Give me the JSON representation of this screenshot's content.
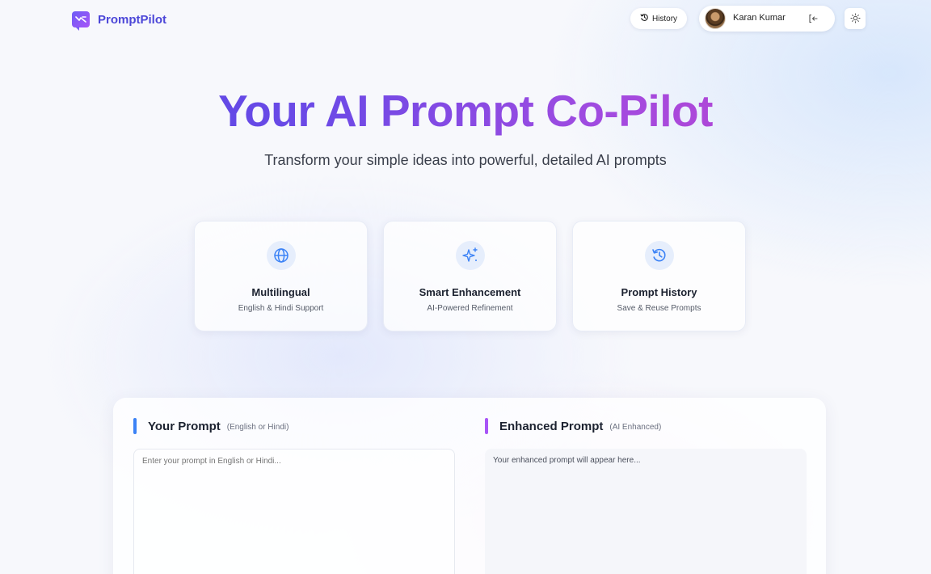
{
  "header": {
    "brand_name": "PromptPilot",
    "history_label": "History",
    "user_name": "Karan Kumar"
  },
  "hero": {
    "title": "Your AI Prompt Co-Pilot",
    "subtitle": "Transform your simple ideas into powerful, detailed AI prompts"
  },
  "features": [
    {
      "icon": "globe-icon",
      "title": "Multilingual",
      "subtitle": "English & Hindi Support"
    },
    {
      "icon": "sparkles-icon",
      "title": "Smart Enhancement",
      "subtitle": "AI-Powered Refinement"
    },
    {
      "icon": "history-icon",
      "title": "Prompt History",
      "subtitle": "Save & Reuse Prompts"
    }
  ],
  "editor": {
    "input": {
      "title": "Your Prompt",
      "note": "(English or Hindi)",
      "placeholder": "Enter your prompt in English or Hindi...",
      "value": "",
      "accent": "#3b82f6"
    },
    "output": {
      "title": "Enhanced Prompt",
      "note": "(AI Enhanced)",
      "placeholder": "Your enhanced prompt will appear here...",
      "accent": "#a855f7"
    }
  },
  "colors": {
    "brand": "#4c47d8",
    "icon_accent": "#3b82f6",
    "gradient_start": "#4f46e5",
    "gradient_end": "#c43fc8"
  }
}
